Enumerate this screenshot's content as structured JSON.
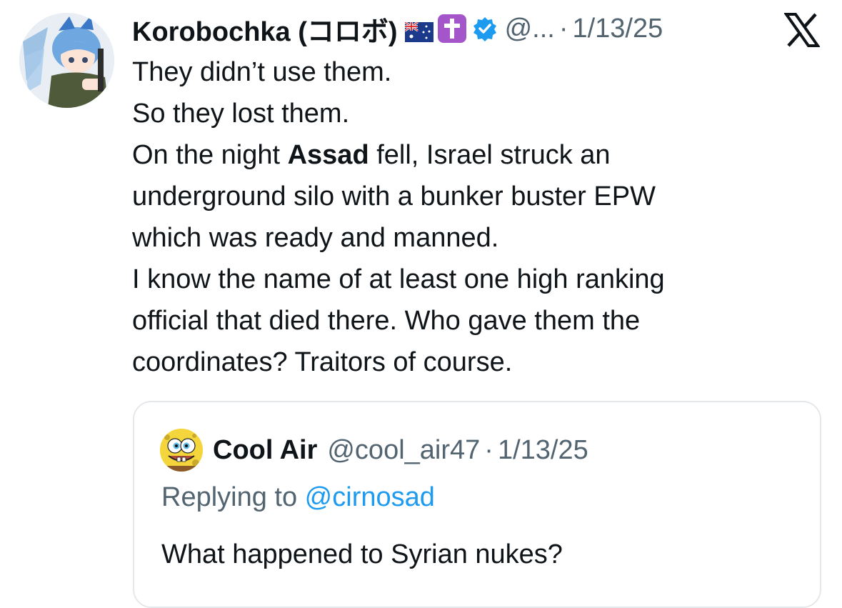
{
  "tweet": {
    "author": {
      "display_name": "Korobochka (コロボ)",
      "handle": "@...",
      "date": "1/13/25",
      "avatar_icon": "anime-character-avatar",
      "badges": [
        "australia-flag-icon",
        "latin-cross-icon",
        "verified-badge-icon"
      ],
      "verified_color": "#1d9bf0"
    },
    "text": {
      "line1": "They didn’t use them.",
      "line2": "So they lost them.",
      "line3_pre": "On the night ",
      "line3_bold": "Assad",
      "line3_post": " fell, Israel struck an",
      "line4": "underground silo with a bunker buster EPW",
      "line5": "which was ready and manned.",
      "line6": "I know the name of at least one high ranking",
      "line7": "official that died there. Who gave them the",
      "line8": "coordinates? Traitors of course."
    }
  },
  "quoted_tweet": {
    "display_name": "Cool Air",
    "handle": "@cool_air47",
    "date": "1/13/25",
    "avatar_icon": "spongebob-avatar",
    "replying_prefix": "Replying to ",
    "replying_to": "@cirnosad",
    "text": "What happened to Syrian nukes?"
  },
  "separator": "·",
  "brand_icon": "x-logo-icon",
  "colors": {
    "text": "#0f1419",
    "secondary": "#536471",
    "link": "#1d9bf0",
    "border": "#e5e8eb",
    "cross_badge": "#a455c9"
  }
}
